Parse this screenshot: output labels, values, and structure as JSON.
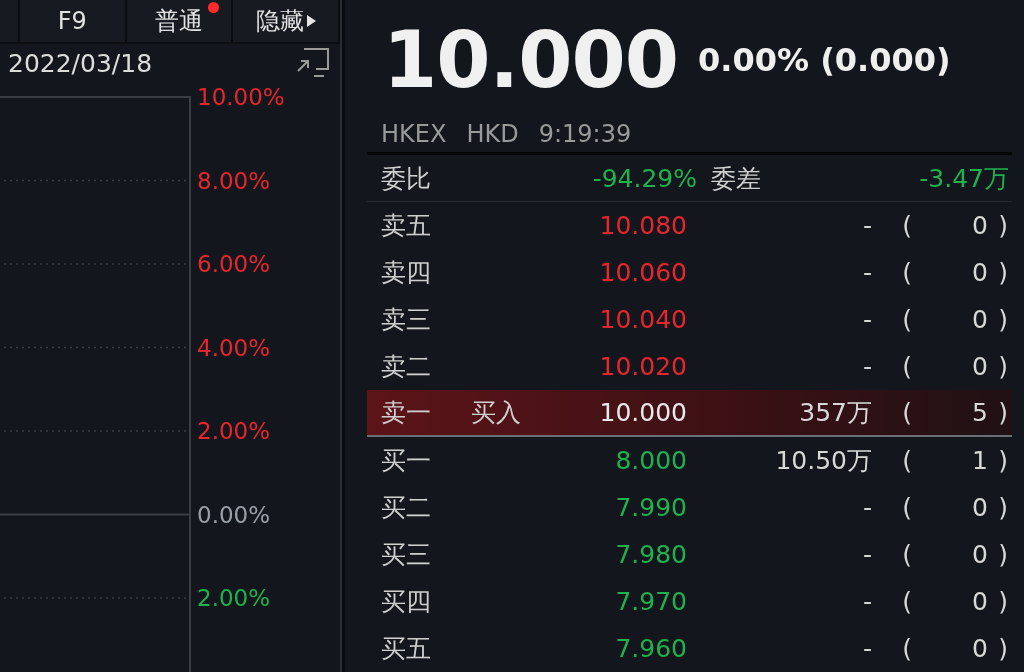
{
  "toolbar": {
    "tabs": [
      {
        "label": "F9",
        "kind": "plain",
        "notify": false
      },
      {
        "label": "普通",
        "kind": "plain",
        "notify": true
      },
      {
        "label": "隐藏",
        "kind": "menu",
        "notify": false
      }
    ]
  },
  "chart": {
    "date": "2022/03/18",
    "axis_labels": [
      {
        "text": "10.00%",
        "color": "#e5262d"
      },
      {
        "text": "8.00%",
        "color": "#e5262d"
      },
      {
        "text": "6.00%",
        "color": "#e5262d"
      },
      {
        "text": "4.00%",
        "color": "#e5262d"
      },
      {
        "text": "2.00%",
        "color": "#e5262d"
      },
      {
        "text": "0.00%",
        "color": "#9aa0a8"
      },
      {
        "text": "2.00%",
        "color": "#1fb14d"
      }
    ]
  },
  "quote": {
    "price": "10.000",
    "change": "0.00% (0.000)",
    "exchange": "HKEX",
    "currency": "HKD",
    "time": "9:19:39"
  },
  "ratio": {
    "ratio_label": "委比",
    "ratio": "-94.29%",
    "diff_label": "委差",
    "diff": "-3.47万",
    "color": "#1fb14d"
  },
  "book": [
    {
      "label": "卖五",
      "price": "10.080",
      "color": "#e5262d",
      "volume": "-",
      "open": "(",
      "count": "0",
      "close": ")",
      "selected": false
    },
    {
      "label": "卖四",
      "price": "10.060",
      "color": "#e5262d",
      "volume": "-",
      "open": "(",
      "count": "0",
      "close": ")",
      "selected": false
    },
    {
      "label": "卖三",
      "price": "10.040",
      "color": "#e5262d",
      "volume": "-",
      "open": "(",
      "count": "0",
      "close": ")",
      "selected": false
    },
    {
      "label": "卖二",
      "price": "10.020",
      "color": "#e5262d",
      "volume": "-",
      "open": "(",
      "count": "0",
      "close": ")",
      "selected": false
    },
    {
      "label": "卖一",
      "tag": "买入",
      "price": "10.000",
      "color": "#e8e8e8",
      "volume": "357万",
      "open": "(",
      "count": "5",
      "close": ")",
      "selected": true
    },
    {
      "label": "买一",
      "price": "8.000",
      "color": "#1fb14d",
      "volume": "10.50万",
      "open": "(",
      "count": "1",
      "close": ")",
      "selected": false
    },
    {
      "label": "买二",
      "price": "7.990",
      "color": "#1fb14d",
      "volume": "-",
      "open": "(",
      "count": "0",
      "close": ")",
      "selected": false
    },
    {
      "label": "买三",
      "price": "7.980",
      "color": "#1fb14d",
      "volume": "-",
      "open": "(",
      "count": "0",
      "close": ")",
      "selected": false
    },
    {
      "label": "买四",
      "price": "7.970",
      "color": "#1fb14d",
      "volume": "-",
      "open": "(",
      "count": "0",
      "close": ")",
      "selected": false
    },
    {
      "label": "买五",
      "price": "7.960",
      "color": "#1fb14d",
      "volume": "-",
      "open": "(",
      "count": "0",
      "close": ")",
      "selected": false
    }
  ]
}
